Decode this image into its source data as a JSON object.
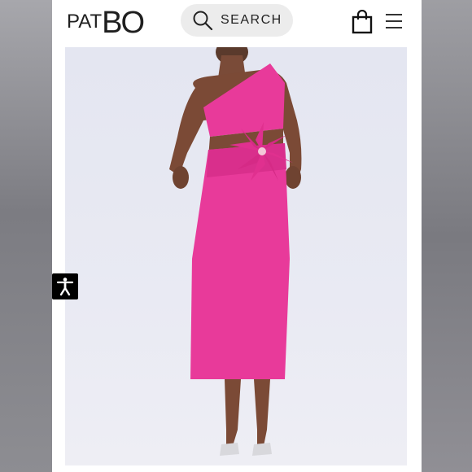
{
  "brand": {
    "logo_pat": "PAT",
    "logo_bo": "BO"
  },
  "search": {
    "label": "SEARCH"
  },
  "icons": {
    "search": "search-icon",
    "bag": "shopping-bag-icon",
    "menu": "hamburger-menu-icon",
    "accessibility": "accessibility-icon"
  },
  "colors": {
    "dress": "#e83a9a",
    "background": "#e6e7f1",
    "accessibility_button": "#000000"
  }
}
